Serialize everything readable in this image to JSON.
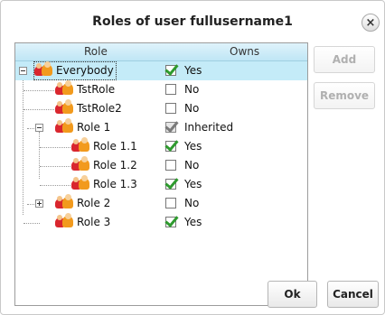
{
  "dialog": {
    "title": "Roles of user fullusername1",
    "close_label": "×"
  },
  "tree": {
    "columns": {
      "role": "Role",
      "owns": "Owns"
    },
    "rows": [
      {
        "label": "Everybody",
        "owns": "Yes",
        "owns_state": "checked",
        "expander": "minus",
        "selected": true
      },
      {
        "label": "TstRole",
        "owns": "No",
        "owns_state": "unchecked"
      },
      {
        "label": "TstRole2",
        "owns": "No",
        "owns_state": "unchecked"
      },
      {
        "label": "Role 1",
        "owns": "Inherited",
        "owns_state": "inherited",
        "expander": "minus"
      },
      {
        "label": "Role 1.1",
        "owns": "Yes",
        "owns_state": "checked"
      },
      {
        "label": "Role 1.2",
        "owns": "No",
        "owns_state": "unchecked"
      },
      {
        "label": "Role 1.3",
        "owns": "Yes",
        "owns_state": "checked"
      },
      {
        "label": "Role 2",
        "owns": "No",
        "owns_state": "unchecked",
        "expander": "plus"
      },
      {
        "label": "Role 3",
        "owns": "Yes",
        "owns_state": "checked"
      }
    ]
  },
  "side_buttons": {
    "add": "Add",
    "remove": "Remove"
  },
  "footer_buttons": {
    "ok": "Ok",
    "cancel": "Cancel"
  },
  "colors": {
    "header_bg": "#c4ebf8",
    "check_green": "#2e9a2e",
    "disabled_text": "#b0b0b0"
  }
}
